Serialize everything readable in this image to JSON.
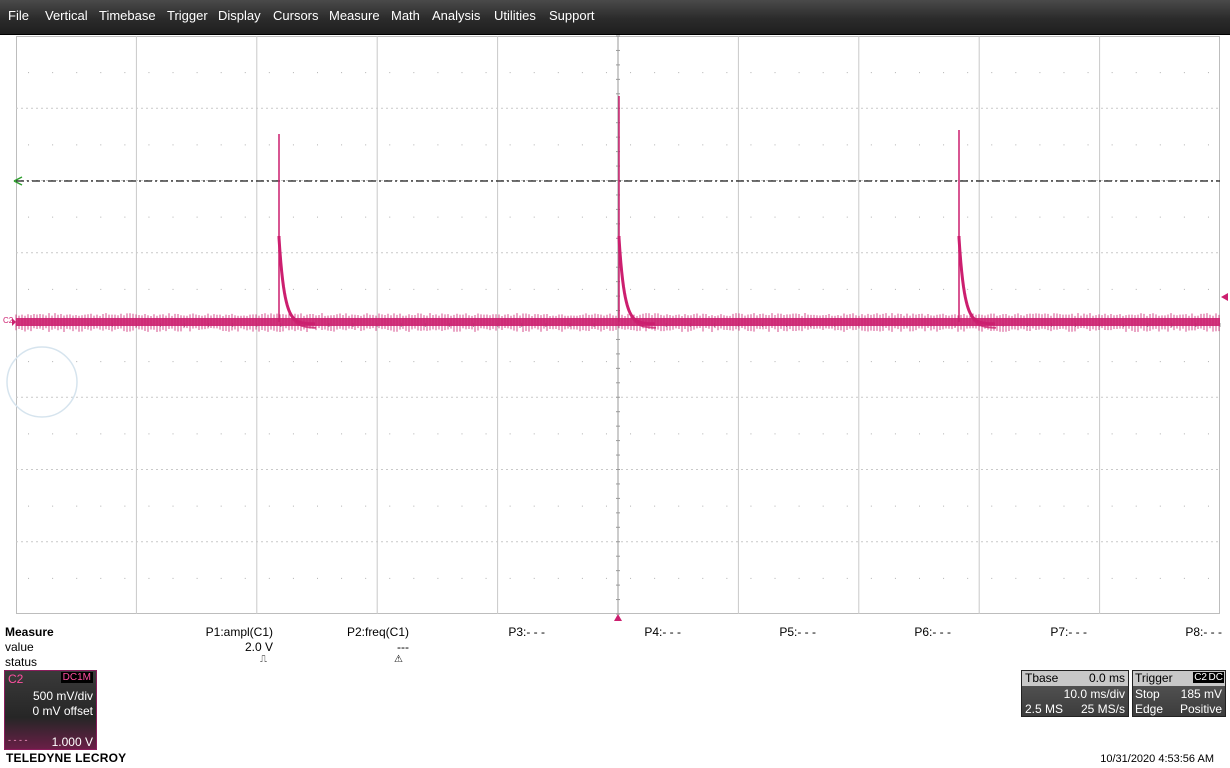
{
  "menu": [
    "File",
    "Vertical",
    "Timebase",
    "Trigger",
    "Display",
    "Cursors",
    "Measure",
    "Math",
    "Analysis",
    "Utilities",
    "Support"
  ],
  "colors": {
    "trace": "#cc1f6f",
    "trigger_level_line": "#1a1a1a",
    "grid": "#c9c9c9",
    "trigger_arrow": "#2e9e2e",
    "menubar": "#2b2b2b"
  },
  "display": {
    "channel_marker": "C2"
  },
  "measure": {
    "title": "Measure",
    "row_labels": [
      "value",
      "status"
    ],
    "params": [
      {
        "name": "P1:ampl(C1)",
        "value": "2.0 V",
        "status": "⎍"
      },
      {
        "name": "P2:freq(C1)",
        "value": "---",
        "status": "⚠"
      },
      {
        "name": "P3:- - -",
        "value": "",
        "status": ""
      },
      {
        "name": "P4:- - -",
        "value": "",
        "status": ""
      },
      {
        "name": "P5:- - -",
        "value": "",
        "status": ""
      },
      {
        "name": "P6:- - -",
        "value": "",
        "status": ""
      },
      {
        "name": "P7:- - -",
        "value": "",
        "status": ""
      },
      {
        "name": "P8:- - -",
        "value": "",
        "status": ""
      }
    ]
  },
  "channel": {
    "name": "C2",
    "coupling": "DC1M",
    "vdiv": "500 mV/div",
    "offset": "0 mV offset",
    "probe": "1.000 V"
  },
  "timebase": {
    "label": "Tbase",
    "delay": "0.0 ms",
    "tdiv": "10.0 ms/div",
    "samples": "2.5 MS",
    "rate": "25 MS/s"
  },
  "trigger": {
    "label": "Trigger",
    "source": "C2",
    "coupling": "DC",
    "mode": "Stop",
    "level": "185 mV",
    "type": "Edge",
    "slope": "Positive"
  },
  "brand": "TELEDYNE LECROY",
  "timestamp": "10/31/2020 4:53:56 AM"
}
